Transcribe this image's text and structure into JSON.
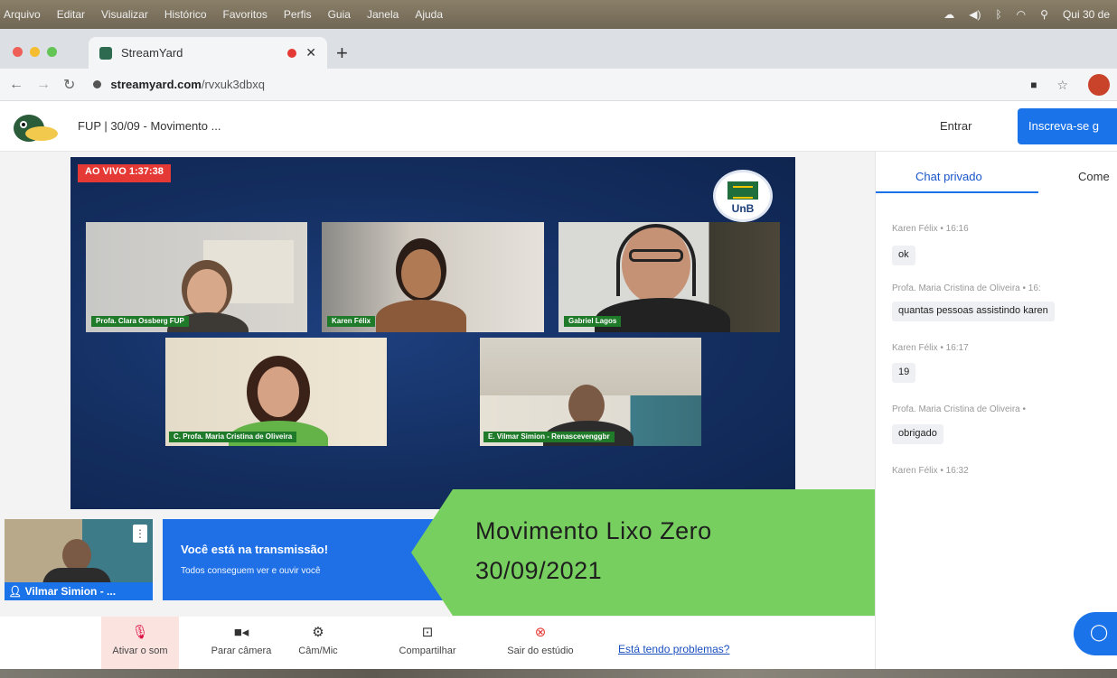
{
  "menubar": {
    "items": [
      "Arquivo",
      "Editar",
      "Visualizar",
      "Histórico",
      "Favoritos",
      "Perfis",
      "Guia",
      "Janela",
      "Ajuda"
    ],
    "clock": "Qui 30 de"
  },
  "browser": {
    "tab_title": "StreamYard",
    "url_domain": "streamyard.com",
    "url_path": "/rvxuk3dbxq"
  },
  "app": {
    "broadcast_title": "FUP | 30/09 - Movimento ...",
    "enter_label": "Entrar",
    "signup_label": "Inscreva-se g"
  },
  "stage": {
    "live_badge": "AO VIVO 1:37:38",
    "logo_text": "UnB",
    "participants": [
      {
        "name": "Profa. Clara Ossberg FUP"
      },
      {
        "name": "Karen Félix"
      },
      {
        "name": "Gabriel Lagos"
      },
      {
        "name": "C. Profa. Maria Cristina de Oliveira"
      },
      {
        "name": "E. Vilmar Simion - Renascevenggbr"
      }
    ]
  },
  "self_preview": {
    "name": "Vilmar Simion - ..."
  },
  "on_air": {
    "title": "Você está na transmissão!",
    "subtitle": "Todos conseguem ver e ouvir você"
  },
  "overlay": {
    "line1": "Movimento Lixo Zero",
    "line2": "30/09/2021",
    "color": "#77cf5f"
  },
  "controls": [
    {
      "label": "Ativar o som",
      "icon": "mic-off-icon"
    },
    {
      "label": "Parar câmera",
      "icon": "camera-icon"
    },
    {
      "label": "Câm/Mic",
      "icon": "gear-icon"
    },
    {
      "label": "Compartilhar",
      "icon": "share-screen-icon"
    },
    {
      "label": "Sair do estúdio",
      "icon": "leave-icon"
    }
  ],
  "help_link": "Está tendo problemas?",
  "chat": {
    "tab_private": "Chat privado",
    "tab_comments": "Come",
    "messages": [
      {
        "author": "Karen Félix • 16:16",
        "text": "ok"
      },
      {
        "author": "Profa. Maria Cristina de Oliveira • 16:",
        "text": "quantas pessoas assistindo karen"
      },
      {
        "author": "Karen Félix • 16:17",
        "text": "19"
      },
      {
        "author": "Profa. Maria Cristina de Oliveira •",
        "text": "obrigado"
      },
      {
        "author": "Karen Félix • 16:32",
        "text": ""
      }
    ]
  },
  "colors": {
    "stage_bg": "#132d5e",
    "live_red": "#e53935",
    "brand_blue": "#1a73e8",
    "name_tag_green": "#1f7a2a"
  }
}
